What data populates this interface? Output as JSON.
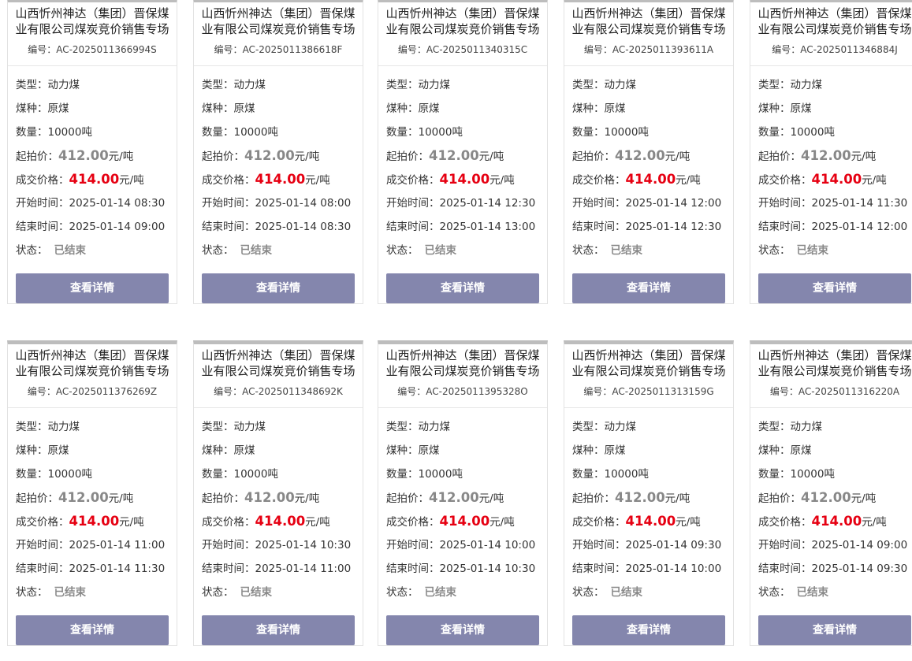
{
  "labels": {
    "code_prefix": "编号：",
    "type": "类型：",
    "coal": "煤种：",
    "qty": "数量：",
    "start_price": "起拍价：",
    "deal_price": "成交价格：",
    "start_time": "开始时间：",
    "end_time": "结束时间：",
    "status": "状态：",
    "unit": "元/吨",
    "detail_button": "查看详情"
  },
  "cards": [
    {
      "title": "山西忻州神达（集团）晋保煤业有限公司煤炭竞价销售专场",
      "code": "AC-2025011366994S",
      "type": "动力煤",
      "coal": "原煤",
      "qty": "10000吨",
      "start_price": "412.00",
      "deal_price": "414.00",
      "start_time": "2025-01-14 08:30",
      "end_time": "2025-01-14 09:00",
      "status": "已结束"
    },
    {
      "title": "山西忻州神达（集团）晋保煤业有限公司煤炭竞价销售专场",
      "code": "AC-2025011386618F",
      "type": "动力煤",
      "coal": "原煤",
      "qty": "10000吨",
      "start_price": "412.00",
      "deal_price": "414.00",
      "start_time": "2025-01-14 08:00",
      "end_time": "2025-01-14 08:30",
      "status": "已结束"
    },
    {
      "title": "山西忻州神达（集团）晋保煤业有限公司煤炭竞价销售专场",
      "code": "AC-2025011340315C",
      "type": "动力煤",
      "coal": "原煤",
      "qty": "10000吨",
      "start_price": "412.00",
      "deal_price": "414.00",
      "start_time": "2025-01-14 12:30",
      "end_time": "2025-01-14 13:00",
      "status": "已结束"
    },
    {
      "title": "山西忻州神达（集团）晋保煤业有限公司煤炭竞价销售专场",
      "code": "AC-2025011393611A",
      "type": "动力煤",
      "coal": "原煤",
      "qty": "10000吨",
      "start_price": "412.00",
      "deal_price": "414.00",
      "start_time": "2025-01-14 12:00",
      "end_time": "2025-01-14 12:30",
      "status": "已结束"
    },
    {
      "title": "山西忻州神达（集团）晋保煤业有限公司煤炭竞价销售专场",
      "code": "AC-2025011346884J",
      "type": "动力煤",
      "coal": "原煤",
      "qty": "10000吨",
      "start_price": "412.00",
      "deal_price": "414.00",
      "start_time": "2025-01-14 11:30",
      "end_time": "2025-01-14 12:00",
      "status": "已结束"
    },
    {
      "title": "山西忻州神达（集团）晋保煤业有限公司煤炭竞价销售专场",
      "code": "AC-2025011376269Z",
      "type": "动力煤",
      "coal": "原煤",
      "qty": "10000吨",
      "start_price": "412.00",
      "deal_price": "414.00",
      "start_time": "2025-01-14 11:00",
      "end_time": "2025-01-14 11:30",
      "status": "已结束"
    },
    {
      "title": "山西忻州神达（集团）晋保煤业有限公司煤炭竞价销售专场",
      "code": "AC-2025011348692K",
      "type": "动力煤",
      "coal": "原煤",
      "qty": "10000吨",
      "start_price": "412.00",
      "deal_price": "414.00",
      "start_time": "2025-01-14 10:30",
      "end_time": "2025-01-14 11:00",
      "status": "已结束"
    },
    {
      "title": "山西忻州神达（集团）晋保煤业有限公司煤炭竞价销售专场",
      "code": "AC-2025011395328O",
      "type": "动力煤",
      "coal": "原煤",
      "qty": "10000吨",
      "start_price": "412.00",
      "deal_price": "414.00",
      "start_time": "2025-01-14 10:00",
      "end_time": "2025-01-14 10:30",
      "status": "已结束"
    },
    {
      "title": "山西忻州神达（集团）晋保煤业有限公司煤炭竞价销售专场",
      "code": "AC-2025011313159G",
      "type": "动力煤",
      "coal": "原煤",
      "qty": "10000吨",
      "start_price": "412.00",
      "deal_price": "414.00",
      "start_time": "2025-01-14 09:30",
      "end_time": "2025-01-14 10:00",
      "status": "已结束"
    },
    {
      "title": "山西忻州神达（集团）晋保煤业有限公司煤炭竞价销售专场",
      "code": "AC-2025011316220A",
      "type": "动力煤",
      "coal": "原煤",
      "qty": "10000吨",
      "start_price": "412.00",
      "deal_price": "414.00",
      "start_time": "2025-01-14 09:00",
      "end_time": "2025-01-14 09:30",
      "status": "已结束"
    }
  ]
}
